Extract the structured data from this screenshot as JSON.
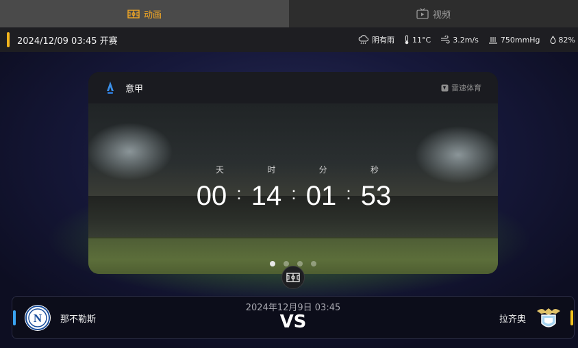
{
  "tabs": [
    {
      "label": "动画",
      "icon": "pitch-icon",
      "active": true
    },
    {
      "label": "视频",
      "icon": "tv-icon",
      "active": false
    }
  ],
  "info": {
    "start_time": "2024/12/09 03:45 开赛",
    "weather": {
      "condition": "阴有雨",
      "temperature": "11°C",
      "wind": "3.2m/s",
      "pressure": "750mmHg",
      "humidity": "82%"
    }
  },
  "card": {
    "league": "意甲",
    "brand": "雷速体育",
    "countdown": {
      "labels": {
        "days": "天",
        "hours": "时",
        "minutes": "分",
        "seconds": "秒"
      },
      "days": "00",
      "hours": "14",
      "minutes": "01",
      "seconds": "53",
      "separator": ":"
    },
    "carousel": {
      "count": 4,
      "active_index": 0
    }
  },
  "match": {
    "date": "2024年12月9日 03:45",
    "vs": "VS",
    "home": {
      "name": "那不勒斯",
      "crest_letter": "N"
    },
    "away": {
      "name": "拉齐奥"
    }
  },
  "colors": {
    "accent": "#f3a825",
    "home_bar": "#3aa4f2",
    "away_bar": "#f3c21d"
  }
}
